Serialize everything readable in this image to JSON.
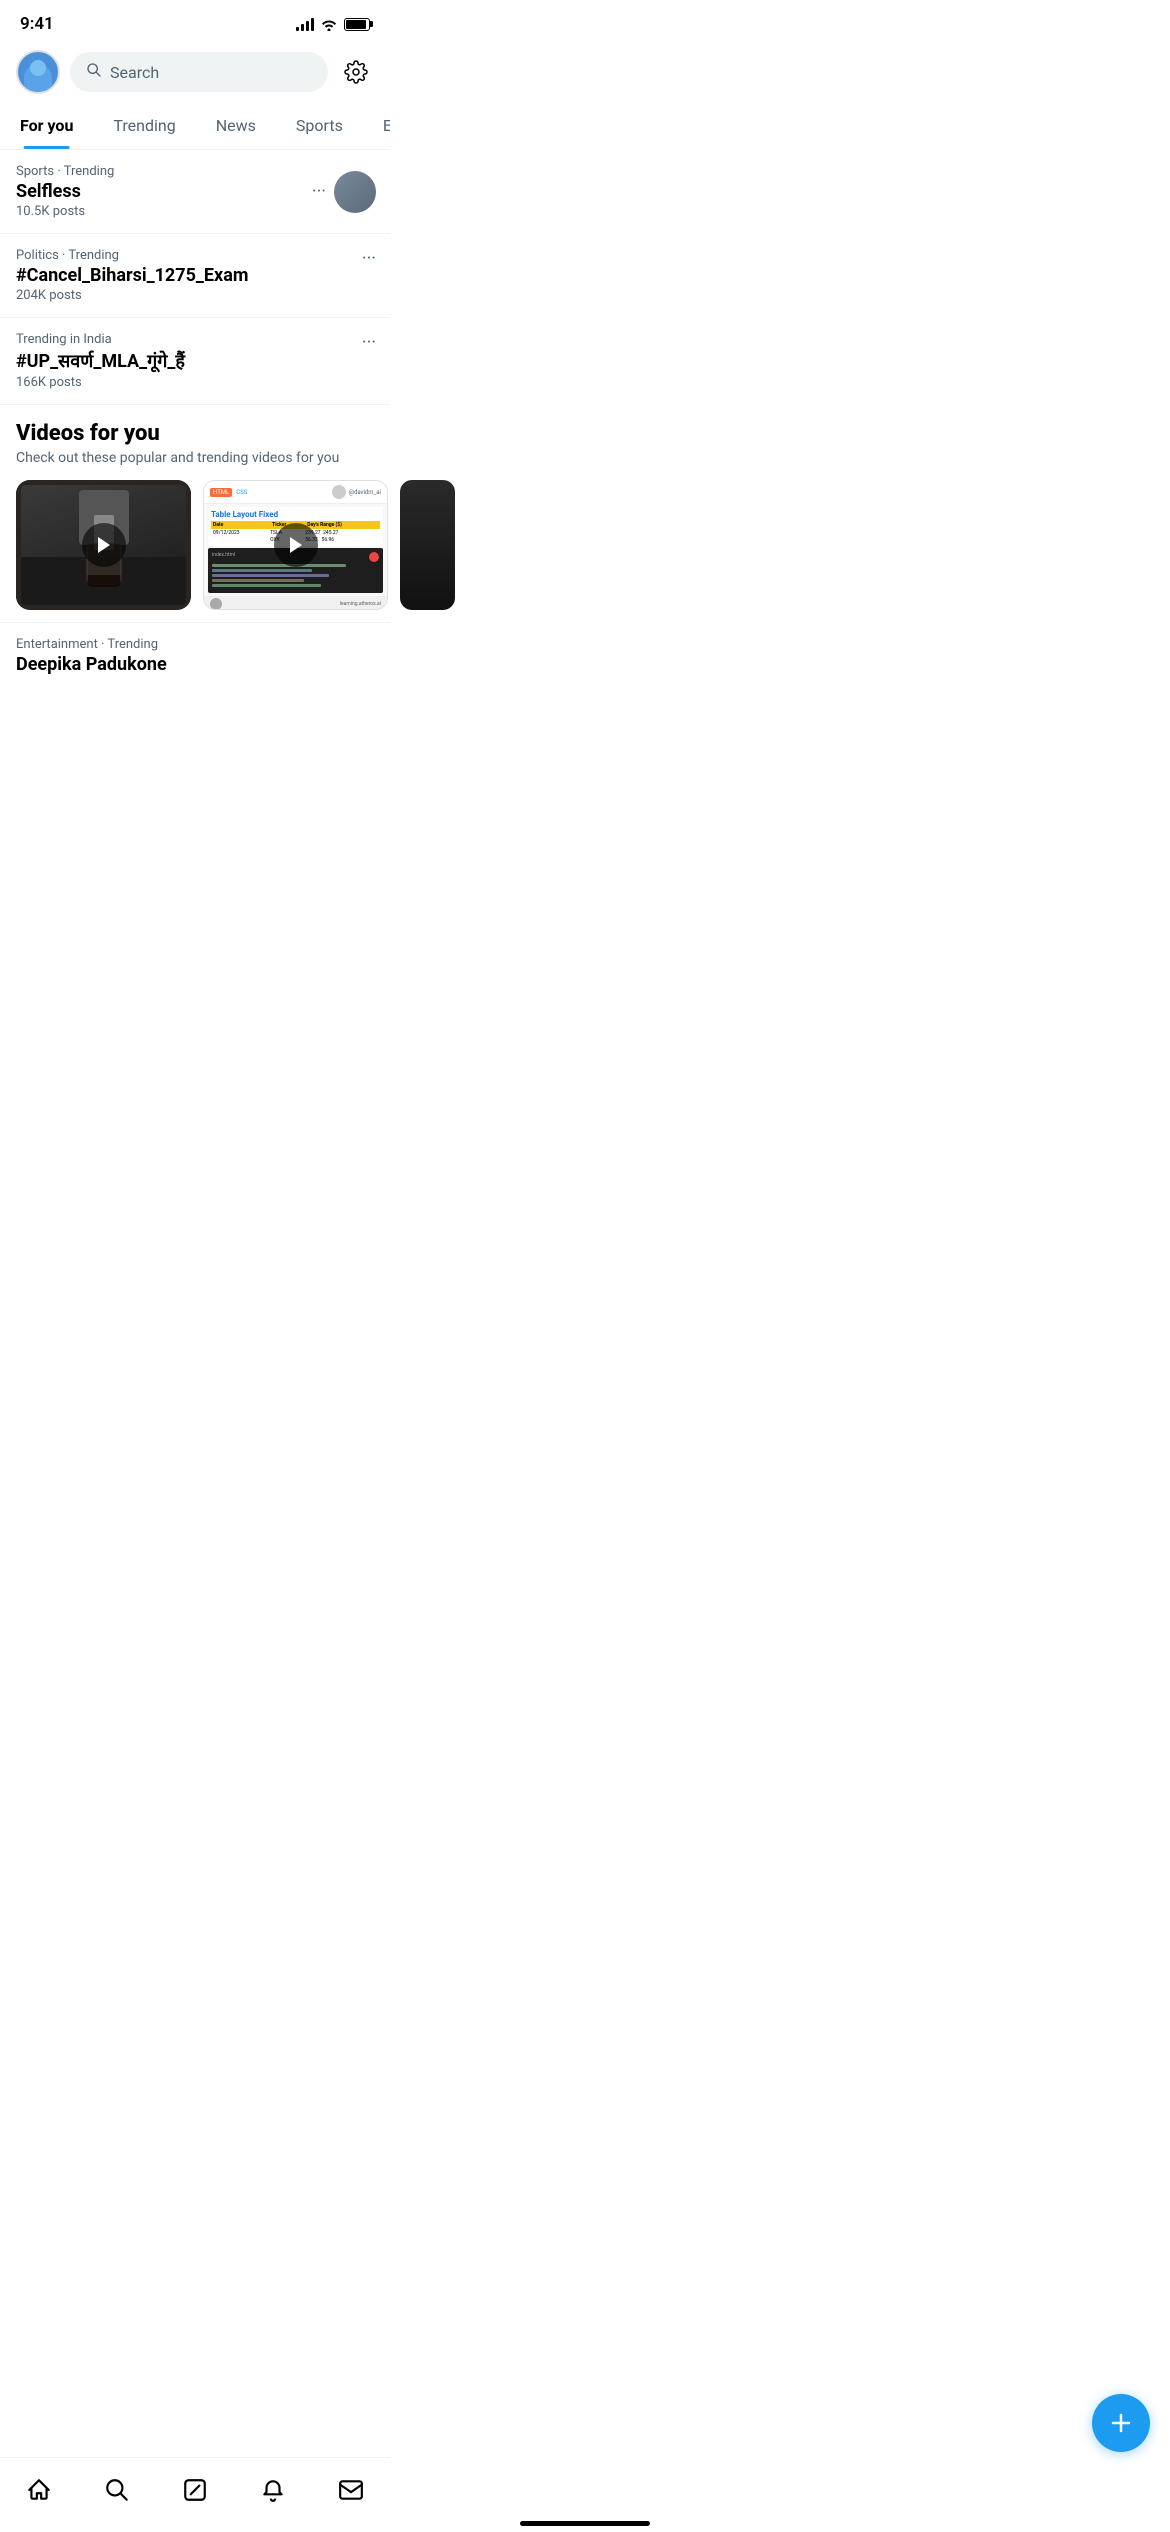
{
  "statusBar": {
    "time": "9:41",
    "signal": "signal-icon",
    "wifi": "wifi-icon",
    "battery": "battery-icon"
  },
  "header": {
    "searchPlaceholder": "Search",
    "settingsIcon": "gear-icon"
  },
  "navTabs": {
    "tabs": [
      {
        "id": "for-you",
        "label": "For you",
        "active": true
      },
      {
        "id": "trending",
        "label": "Trending",
        "active": false
      },
      {
        "id": "news",
        "label": "News",
        "active": false
      },
      {
        "id": "sports",
        "label": "Sports",
        "active": false
      },
      {
        "id": "entertainment",
        "label": "Entertainment",
        "active": false
      }
    ]
  },
  "trending": {
    "items": [
      {
        "meta": "Sports · Trending",
        "title": "Selfless",
        "posts": "10.5K posts",
        "hasAvatar": true
      },
      {
        "meta": "Politics · Trending",
        "title": "#Cancel_Biharsi_1275_Exam",
        "posts": "204K posts",
        "hasAvatar": false
      },
      {
        "meta": "Trending in India",
        "title": "#UP_सवर्ण_MLA_गूंगे_हैं",
        "posts": "166K posts",
        "hasAvatar": false
      }
    ]
  },
  "videosSection": {
    "title": "Videos for you",
    "subtitle": "Check out these popular and trending videos for you",
    "cards": [
      {
        "id": "video-1",
        "type": "coffee"
      },
      {
        "id": "video-2",
        "type": "code"
      },
      {
        "id": "video-3",
        "type": "dark"
      }
    ]
  },
  "videoCard2": {
    "tabHtml": "HTML",
    "tabCss": "CSS",
    "userHandle": "@davidm_ai",
    "tableTitle": "Table Layout Fixed",
    "tableHeaders": [
      "Date",
      "Ticker",
      "Day's Range ($)"
    ],
    "tableRows": [
      [
        "09/12/2023",
        "TSLA",
        "239.27",
        "245.27"
      ],
      [
        "",
        "OXY",
        "56.33",
        "56.96"
      ]
    ],
    "codeLine1": "index.html",
    "provider": "learning.atheros.ai"
  },
  "bottomTrending": {
    "meta": "Entertainment · Trending",
    "title": "Deepika Padukone"
  },
  "fab": {
    "label": "+",
    "icon": "plus-icon"
  },
  "bottomNav": {
    "items": [
      {
        "id": "home",
        "icon": "home-icon",
        "symbol": "⌂"
      },
      {
        "id": "search",
        "icon": "search-icon",
        "symbol": "○"
      },
      {
        "id": "compose",
        "icon": "compose-icon",
        "symbol": "⊘"
      },
      {
        "id": "notifications",
        "icon": "bell-icon",
        "symbol": "🔔"
      },
      {
        "id": "messages",
        "icon": "mail-icon",
        "symbol": "✉"
      }
    ]
  }
}
